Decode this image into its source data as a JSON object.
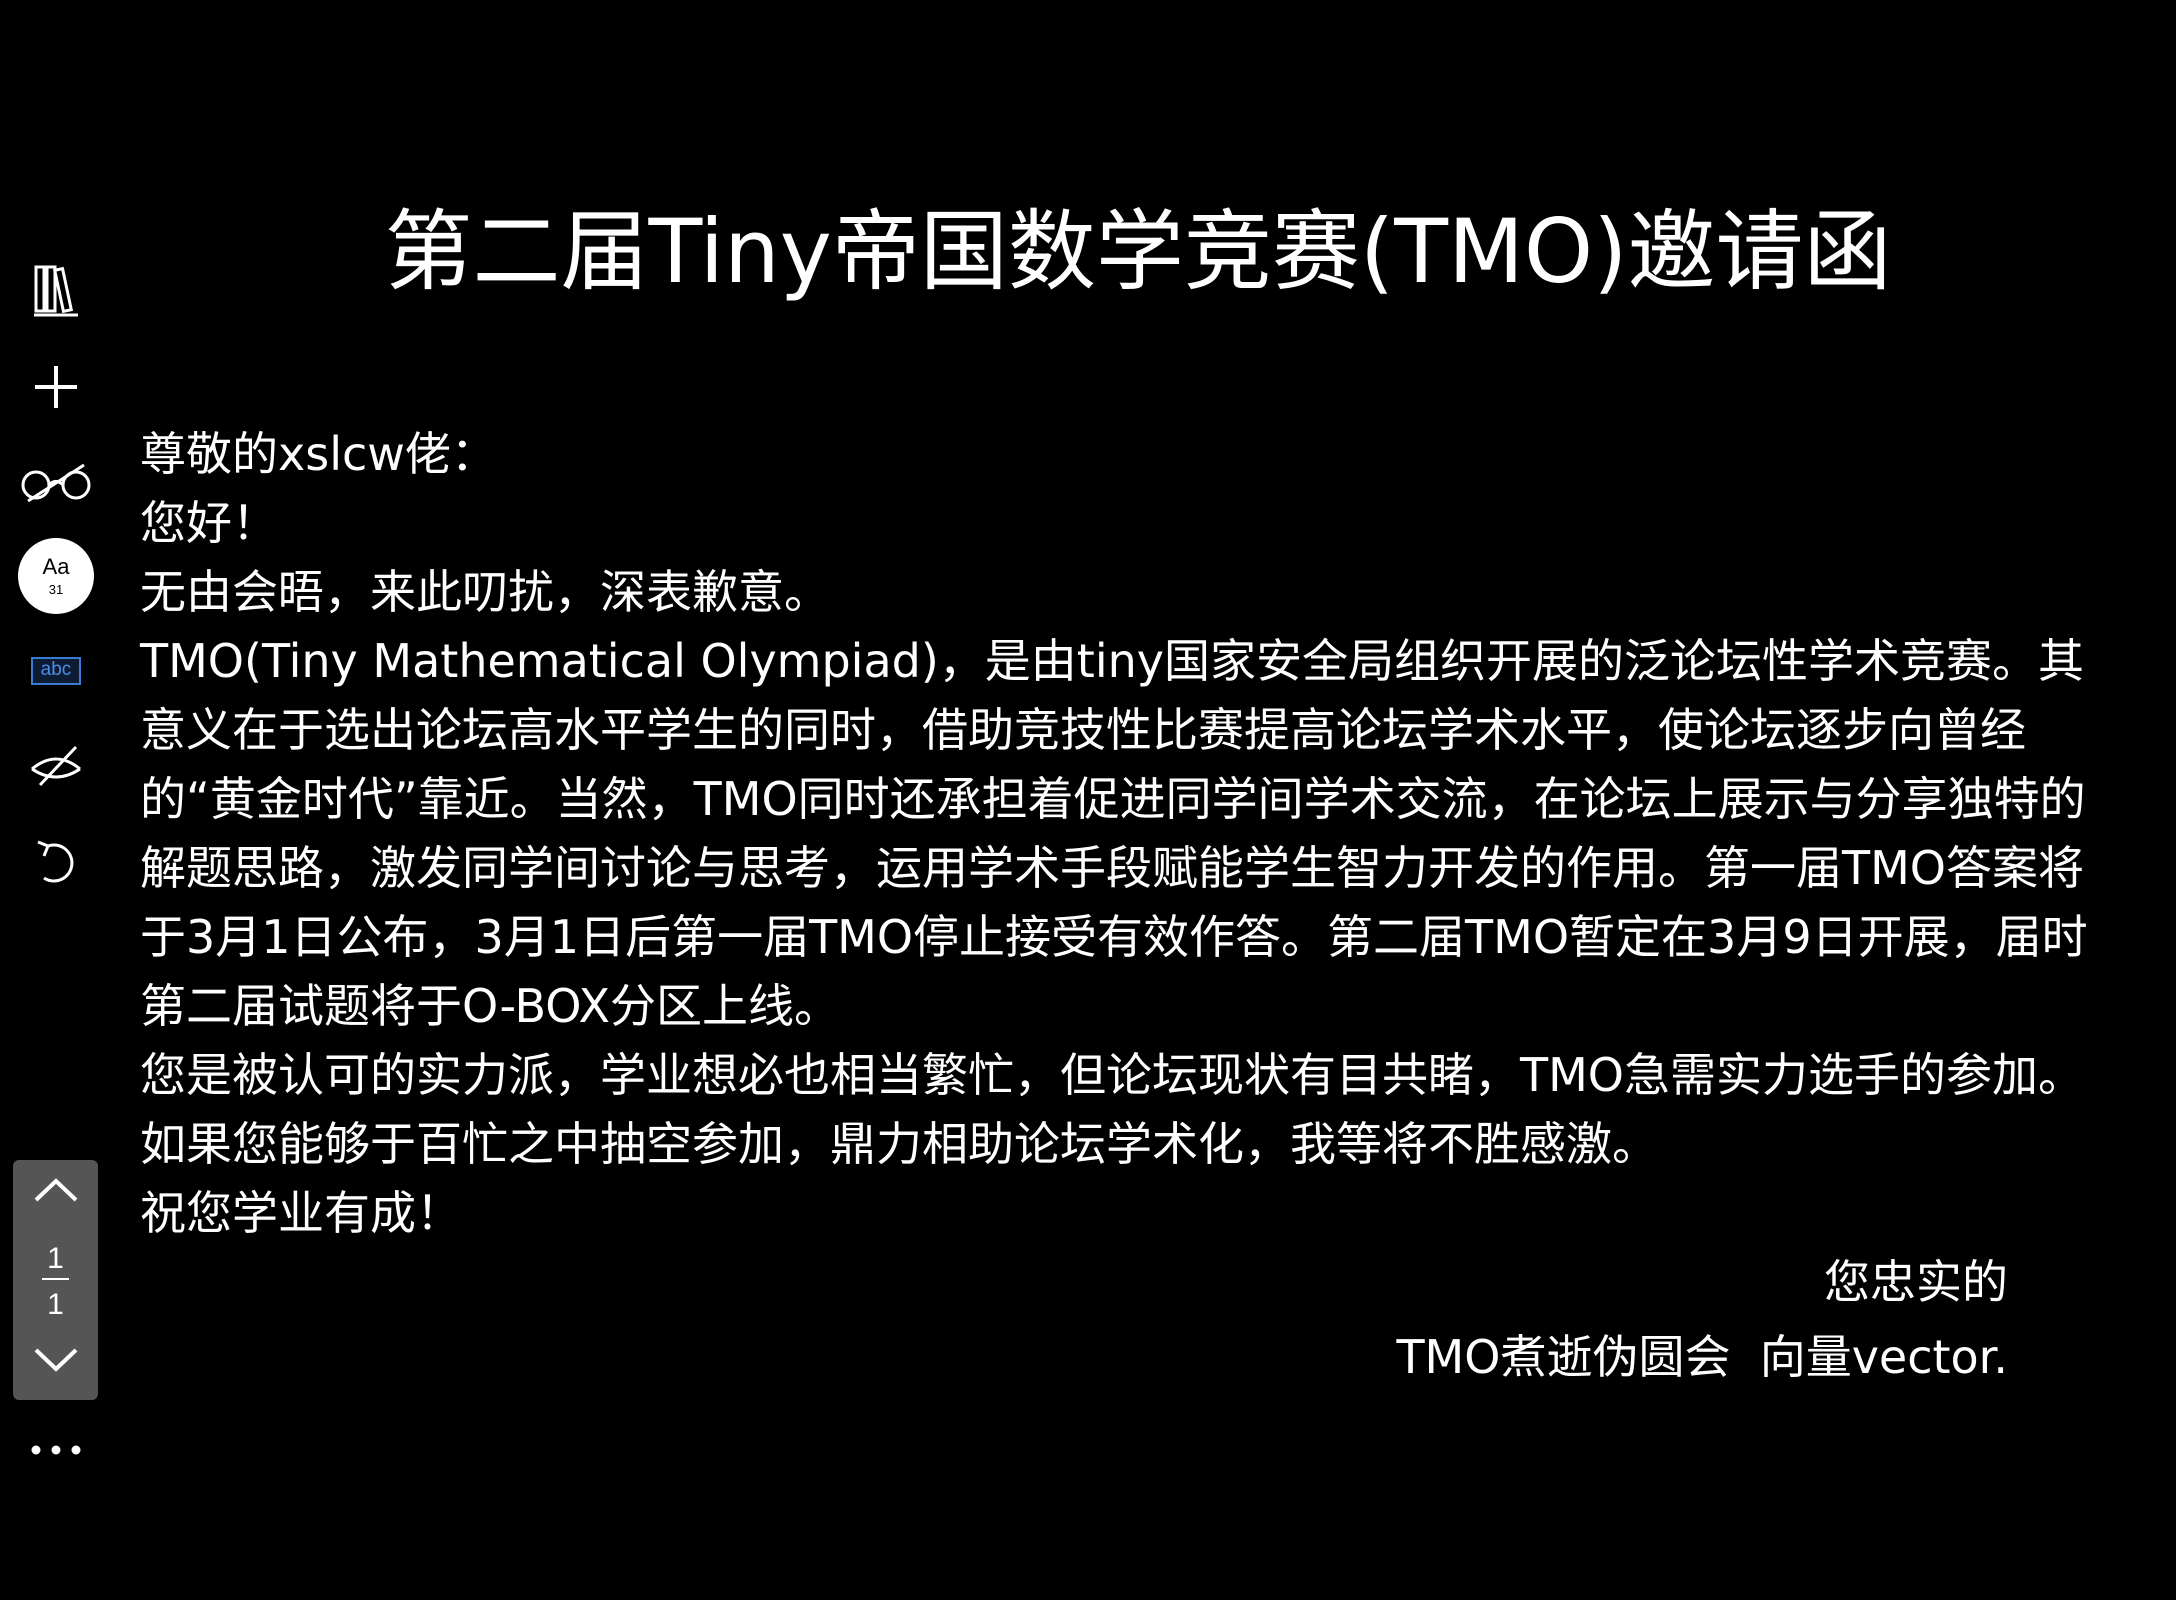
{
  "toolbar": {
    "buttons": [
      {
        "name": "library-icon"
      },
      {
        "name": "add-icon"
      },
      {
        "name": "reading-glasses-icon"
      },
      {
        "name": "font-size-button",
        "label": "Aa",
        "value": "31"
      },
      {
        "name": "spellcheck-button",
        "label": "abc"
      },
      {
        "name": "hide-annotations-icon"
      },
      {
        "name": "undo-icon"
      }
    ],
    "pager": {
      "current_page": "1",
      "total_pages": "1"
    },
    "more_label": "⋯"
  },
  "document": {
    "title": "第二届Tiny帝国数学竞赛(TMO)邀请函",
    "salutation": "尊敬的xslcw佬：",
    "greeting": "您好！",
    "apology": "无由会晤，来此叨扰，深表歉意。",
    "main_paragraph": "TMO(Tiny Mathematical Olympiad)，是由tiny国家安全局组织开展的泛论坛性学术竞赛。其意义在于选出论坛高水平学生的同时，借助竞技性比赛提高论坛学术水平，使论坛逐步向曾经的“黄金时代”靠近。当然，TMO同时还承担着促进同学间学术交流，在论坛上展示与分享独特的解题思路，激发同学间讨论与思考，运用学术手段赋能学生智力开发的作用。第一届TMO答案将于3月1日公布，3月1日后第一届TMO停止接受有效作答。第二届TMO暂定在3月9日开展，届时第二届试题将于O-BOX分区上线。",
    "invite_paragraph": "您是被认可的实力派，学业想必也相当繁忙，但论坛现状有目共睹，TMO急需实力选手的参加。如果您能够于百忙之中抽空参加，鼎力相助论坛学术化，我等将不胜感激。",
    "wish": "祝您学业有成！",
    "closing": "您忠实的",
    "signature": "TMO煮逝伪圆会  向量vector."
  }
}
